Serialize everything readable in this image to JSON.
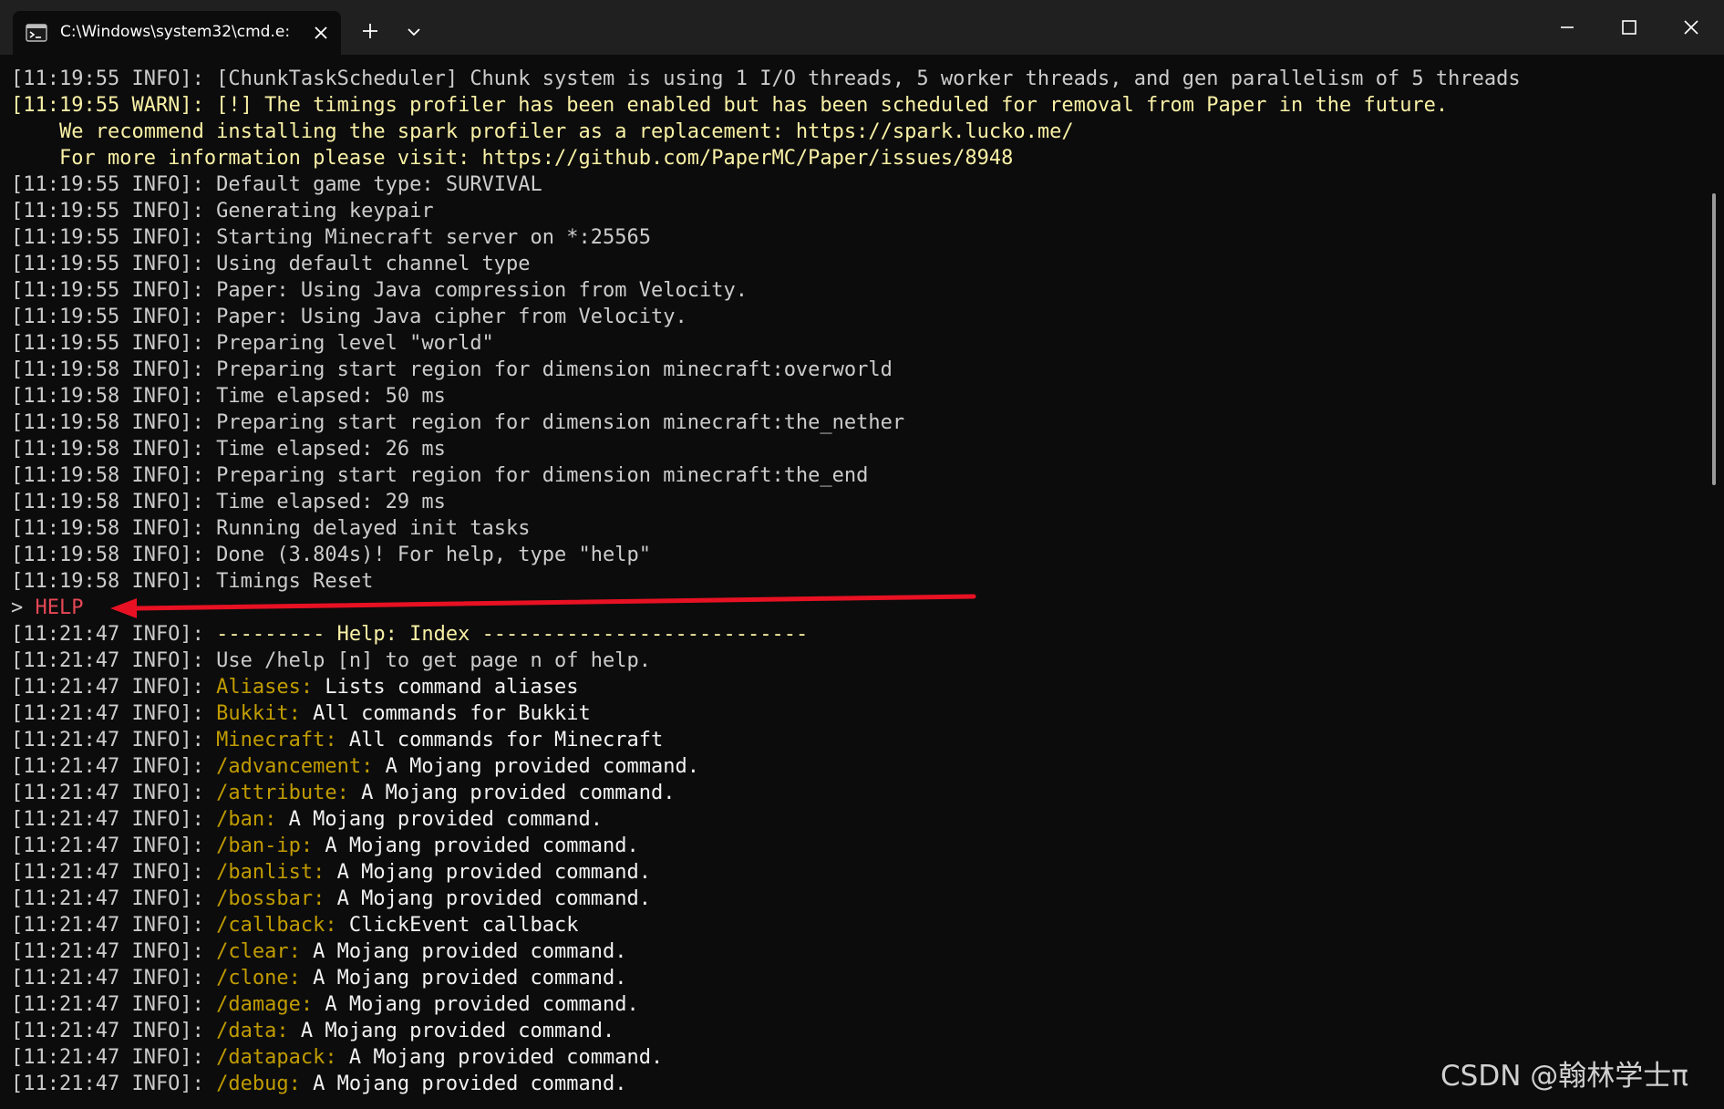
{
  "window": {
    "tab_title": "C:\\Windows\\system32\\cmd.e:",
    "new_tab_label": "+",
    "dropdown_label": "⌄",
    "minimize_label": "−",
    "maximize_label": "□",
    "close_label": "✕"
  },
  "colors": {
    "background": "#0c0c0c",
    "titlebar": "#202020",
    "info_text": "#cccccc",
    "warn_text": "#f9f1a5",
    "command_text": "#c19c00",
    "error_text": "#e74856",
    "annotation_arrow": "#e81123"
  },
  "terminal": {
    "lines": [
      {
        "segs": [
          {
            "t": "[11:19:55 INFO]: [ChunkTaskScheduler] Chunk system is using 1 I/O threads, 5 worker threads, and gen parallelism of 5 threads",
            "c": "info"
          }
        ]
      },
      {
        "segs": [
          {
            "t": "[11:19:55 WARN]: [!] The timings profiler has been enabled but has been scheduled for removal from Paper in the future.",
            "c": "warn"
          }
        ]
      },
      {
        "segs": [
          {
            "t": "    We recommend installing the spark profiler as a replacement: https://spark.lucko.me/",
            "c": "warn"
          }
        ]
      },
      {
        "segs": [
          {
            "t": "    For more information please visit: https://github.com/PaperMC/Paper/issues/8948",
            "c": "warn"
          }
        ]
      },
      {
        "segs": [
          {
            "t": "[11:19:55 INFO]: Default game type: SURVIVAL",
            "c": "info"
          }
        ]
      },
      {
        "segs": [
          {
            "t": "[11:19:55 INFO]: Generating keypair",
            "c": "info"
          }
        ]
      },
      {
        "segs": [
          {
            "t": "[11:19:55 INFO]: Starting Minecraft server on *:25565",
            "c": "info"
          }
        ]
      },
      {
        "segs": [
          {
            "t": "[11:19:55 INFO]: Using default channel type",
            "c": "info"
          }
        ]
      },
      {
        "segs": [
          {
            "t": "[11:19:55 INFO]: Paper: Using Java compression from Velocity.",
            "c": "info"
          }
        ]
      },
      {
        "segs": [
          {
            "t": "[11:19:55 INFO]: Paper: Using Java cipher from Velocity.",
            "c": "info"
          }
        ]
      },
      {
        "segs": [
          {
            "t": "[11:19:55 INFO]: Preparing level \"world\"",
            "c": "info"
          }
        ]
      },
      {
        "segs": [
          {
            "t": "[11:19:58 INFO]: Preparing start region for dimension minecraft:overworld",
            "c": "info"
          }
        ]
      },
      {
        "segs": [
          {
            "t": "[11:19:58 INFO]: Time elapsed: 50 ms",
            "c": "info"
          }
        ]
      },
      {
        "segs": [
          {
            "t": "[11:19:58 INFO]: Preparing start region for dimension minecraft:the_nether",
            "c": "info"
          }
        ]
      },
      {
        "segs": [
          {
            "t": "[11:19:58 INFO]: Time elapsed: 26 ms",
            "c": "info"
          }
        ]
      },
      {
        "segs": [
          {
            "t": "[11:19:58 INFO]: Preparing start region for dimension minecraft:the_end",
            "c": "info"
          }
        ]
      },
      {
        "segs": [
          {
            "t": "[11:19:58 INFO]: Time elapsed: 29 ms",
            "c": "info"
          }
        ]
      },
      {
        "segs": [
          {
            "t": "[11:19:58 INFO]: Running delayed init tasks",
            "c": "info"
          }
        ]
      },
      {
        "segs": [
          {
            "t": "[11:19:58 INFO]: Done (3.804s)! For help, type \"help\"",
            "c": "info"
          }
        ]
      },
      {
        "segs": [
          {
            "t": "[11:19:58 INFO]: Timings Reset",
            "c": "info"
          }
        ]
      },
      {
        "segs": [
          {
            "t": "> ",
            "c": "info"
          },
          {
            "t": "HELP",
            "c": "error"
          }
        ]
      },
      {
        "segs": [
          {
            "t": "[11:21:47 INFO]: ",
            "c": "info"
          },
          {
            "t": "--------- Help: Index ---------------------------",
            "c": "warn"
          }
        ]
      },
      {
        "segs": [
          {
            "t": "[11:21:47 INFO]: Use /help [n] to get page n of help.",
            "c": "info"
          }
        ]
      },
      {
        "segs": [
          {
            "t": "[11:21:47 INFO]: ",
            "c": "info"
          },
          {
            "t": "Aliases: ",
            "c": "cmd"
          },
          {
            "t": "Lists command aliases",
            "c": "bright"
          }
        ]
      },
      {
        "segs": [
          {
            "t": "[11:21:47 INFO]: ",
            "c": "info"
          },
          {
            "t": "Bukkit: ",
            "c": "cmd"
          },
          {
            "t": "All commands for Bukkit",
            "c": "bright"
          }
        ]
      },
      {
        "segs": [
          {
            "t": "[11:21:47 INFO]: ",
            "c": "info"
          },
          {
            "t": "Minecraft: ",
            "c": "cmd"
          },
          {
            "t": "All commands for Minecraft",
            "c": "bright"
          }
        ]
      },
      {
        "segs": [
          {
            "t": "[11:21:47 INFO]: ",
            "c": "info"
          },
          {
            "t": "/advancement: ",
            "c": "cmd"
          },
          {
            "t": "A Mojang provided command.",
            "c": "bright"
          }
        ]
      },
      {
        "segs": [
          {
            "t": "[11:21:47 INFO]: ",
            "c": "info"
          },
          {
            "t": "/attribute: ",
            "c": "cmd"
          },
          {
            "t": "A Mojang provided command.",
            "c": "bright"
          }
        ]
      },
      {
        "segs": [
          {
            "t": "[11:21:47 INFO]: ",
            "c": "info"
          },
          {
            "t": "/ban: ",
            "c": "cmd"
          },
          {
            "t": "A Mojang provided command.",
            "c": "bright"
          }
        ]
      },
      {
        "segs": [
          {
            "t": "[11:21:47 INFO]: ",
            "c": "info"
          },
          {
            "t": "/ban-ip: ",
            "c": "cmd"
          },
          {
            "t": "A Mojang provided command.",
            "c": "bright"
          }
        ]
      },
      {
        "segs": [
          {
            "t": "[11:21:47 INFO]: ",
            "c": "info"
          },
          {
            "t": "/banlist: ",
            "c": "cmd"
          },
          {
            "t": "A Mojang provided command.",
            "c": "bright"
          }
        ]
      },
      {
        "segs": [
          {
            "t": "[11:21:47 INFO]: ",
            "c": "info"
          },
          {
            "t": "/bossbar: ",
            "c": "cmd"
          },
          {
            "t": "A Mojang provided command.",
            "c": "bright"
          }
        ]
      },
      {
        "segs": [
          {
            "t": "[11:21:47 INFO]: ",
            "c": "info"
          },
          {
            "t": "/callback: ",
            "c": "cmd"
          },
          {
            "t": "ClickEvent callback",
            "c": "bright"
          }
        ]
      },
      {
        "segs": [
          {
            "t": "[11:21:47 INFO]: ",
            "c": "info"
          },
          {
            "t": "/clear: ",
            "c": "cmd"
          },
          {
            "t": "A Mojang provided command.",
            "c": "bright"
          }
        ]
      },
      {
        "segs": [
          {
            "t": "[11:21:47 INFO]: ",
            "c": "info"
          },
          {
            "t": "/clone: ",
            "c": "cmd"
          },
          {
            "t": "A Mojang provided command.",
            "c": "bright"
          }
        ]
      },
      {
        "segs": [
          {
            "t": "[11:21:47 INFO]: ",
            "c": "info"
          },
          {
            "t": "/damage: ",
            "c": "cmd"
          },
          {
            "t": "A Mojang provided command.",
            "c": "bright"
          }
        ]
      },
      {
        "segs": [
          {
            "t": "[11:21:47 INFO]: ",
            "c": "info"
          },
          {
            "t": "/data: ",
            "c": "cmd"
          },
          {
            "t": "A Mojang provided command.",
            "c": "bright"
          }
        ]
      },
      {
        "segs": [
          {
            "t": "[11:21:47 INFO]: ",
            "c": "info"
          },
          {
            "t": "/datapack: ",
            "c": "cmd"
          },
          {
            "t": "A Mojang provided command.",
            "c": "bright"
          }
        ]
      },
      {
        "segs": [
          {
            "t": "[11:21:47 INFO]: ",
            "c": "info"
          },
          {
            "t": "/debug: ",
            "c": "cmd"
          },
          {
            "t": "A Mojang provided command.",
            "c": "bright"
          }
        ]
      }
    ]
  },
  "watermark": "CSDN @翰林学士π"
}
